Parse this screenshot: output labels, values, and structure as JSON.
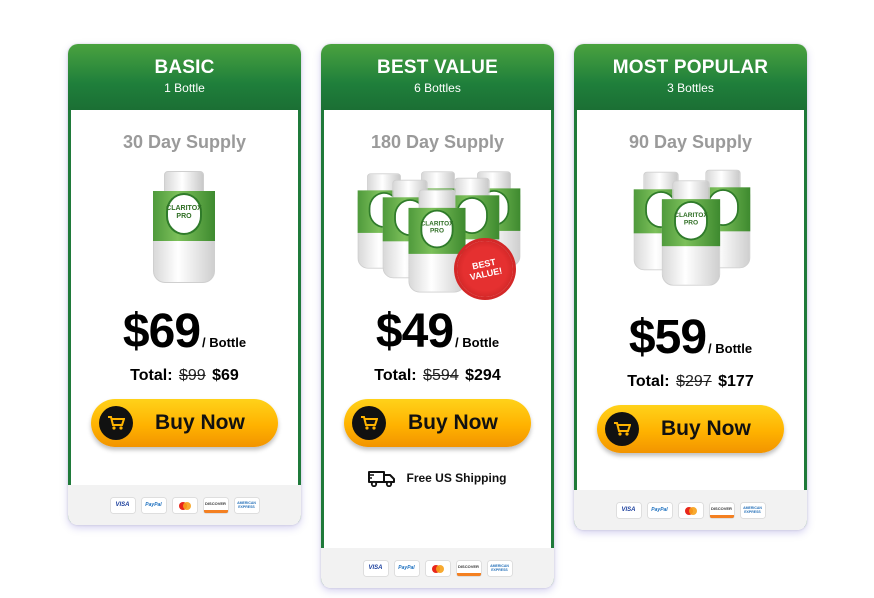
{
  "plans": [
    {
      "title": "BASIC",
      "subtitle": "1 Bottle",
      "supply": "30 Day Supply",
      "price": "$69",
      "per": "/ Bottle",
      "total_label": "Total:",
      "total_old": "$99",
      "total_new": "$69",
      "buy_label": "Buy Now",
      "bottle_label": "CLARITOX PRO",
      "payment_methods": [
        "VISA",
        "PayPal",
        "mastercard",
        "DISCOVER",
        "AMERICAN EXPRESS"
      ]
    },
    {
      "title": "BEST VALUE",
      "subtitle": "6 Bottles",
      "supply": "180 Day Supply",
      "price": "$49",
      "per": "/ Bottle",
      "total_label": "Total:",
      "total_old": "$594",
      "total_new": "$294",
      "buy_label": "Buy Now",
      "bottle_label": "CLARITOX PRO",
      "badge": "BEST VALUE!",
      "shipping": "Free US Shipping",
      "payment_methods": [
        "VISA",
        "PayPal",
        "mastercard",
        "DISCOVER",
        "AMERICAN EXPRESS"
      ]
    },
    {
      "title": "MOST POPULAR",
      "subtitle": "3 Bottles",
      "supply": "90 Day Supply",
      "price": "$59",
      "per": "/ Bottle",
      "total_label": "Total:",
      "total_old": "$297",
      "total_new": "$177",
      "buy_label": "Buy Now",
      "bottle_label": "CLARITOX PRO",
      "payment_methods": [
        "VISA",
        "PayPal",
        "mastercard",
        "DISCOVER",
        "AMERICAN EXPRESS"
      ]
    }
  ],
  "colors": {
    "header_green": "#1f7f3b",
    "button_orange": "#ffb200",
    "badge_red": "#e53030"
  },
  "icons": {
    "cart": "shopping-cart-icon",
    "truck": "delivery-truck-icon"
  }
}
